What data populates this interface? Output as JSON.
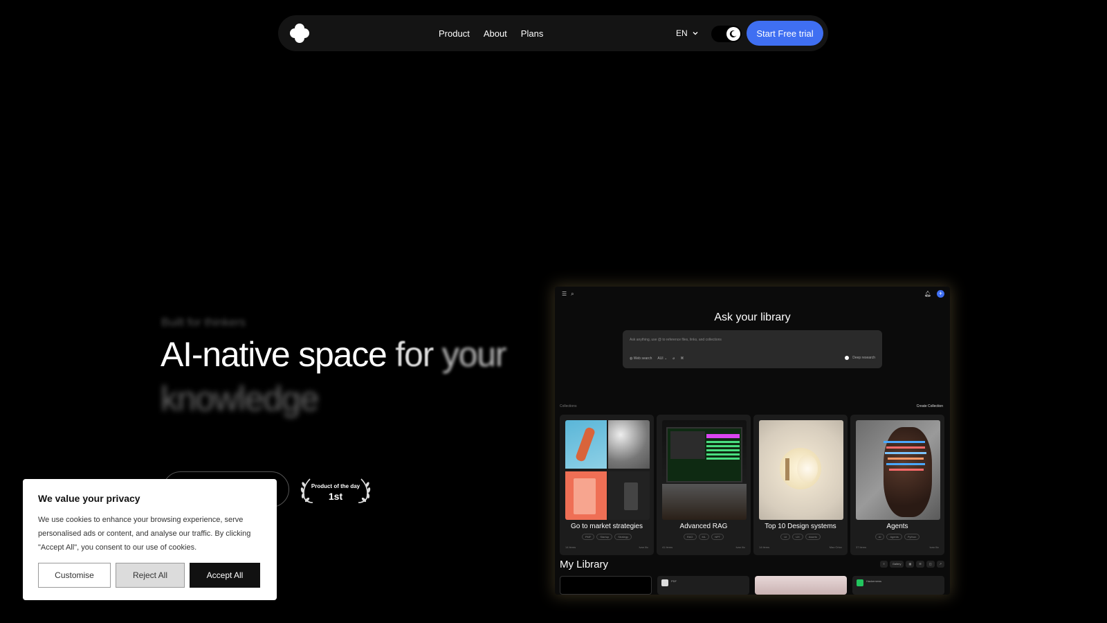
{
  "nav": {
    "links": [
      "Product",
      "About",
      "Plans"
    ],
    "language": "EN",
    "cta": "Start Free trial"
  },
  "hero": {
    "tagline": "Built for thinkers",
    "headline_words": [
      "AI-native space",
      "for",
      "your",
      "knowledge"
    ],
    "badge_label": "Product of the day",
    "badge_rank": "1st"
  },
  "cookie": {
    "title": "We value your privacy",
    "text": "We use cookies to enhance your browsing experience, serve personalised ads or content, and analyse our traffic. By clicking \"Accept All\", you consent to our use of cookies.",
    "customise": "Customise",
    "reject": "Reject All",
    "accept": "Accept All"
  },
  "app": {
    "ask_title": "Ask your library",
    "ask_placeholder": "Ask anything, use @ to reference files, links, and collections",
    "tools": [
      "Web search",
      "AUI"
    ],
    "deep_research": "Deep research",
    "collections_label": "Collections",
    "create_collection": "Create Collection",
    "collections": [
      {
        "title": "Go to market strategies",
        "tags": [
          "PMF",
          "Startup",
          "Strategy"
        ],
        "count": "14 items",
        "owner": "Ivan Ilic"
      },
      {
        "title": "Advanced RAG",
        "tags": [
          "RAG",
          "ML",
          "NPT"
        ],
        "count": "41 items",
        "owner": "Ivan Ilic"
      },
      {
        "title": "Top 10 Design systems",
        "tags": [
          "UI",
          "UX",
          "Assets"
        ],
        "count": "14 items",
        "owner": "Max Orlov"
      },
      {
        "title": "Agents",
        "tags": [
          "AI",
          "Agents",
          "Python"
        ],
        "count": "37 items",
        "owner": "Ivan Ilic"
      }
    ],
    "my_library": "My Library",
    "view_mode": "Gallery",
    "lib_items": [
      "",
      "PDF",
      "",
      "Hackernews"
    ]
  },
  "colors": {
    "accent": "#3f6ff2",
    "background": "#000000"
  }
}
